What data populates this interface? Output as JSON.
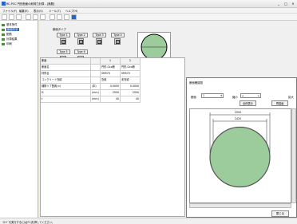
{
  "window": {
    "title": "RC-PCC 円形断面の耐荷力計算 - [無題]",
    "controls": [
      "_",
      "□",
      "×"
    ]
  },
  "menu": [
    "ファイル(F)",
    "編集(E)",
    "表示(V)",
    "ツール(T)",
    "ヘルプ(H)"
  ],
  "tree": [
    "基本条件",
    "断面形状",
    "配筋",
    "計算結果",
    "印刷"
  ],
  "section_group": {
    "title": "断面タイプ",
    "types": [
      "Type 1",
      "Type 2",
      "Type 3",
      "Type 4",
      "Type 5",
      "Type 6"
    ],
    "count_label": "断面数",
    "count_value": "1",
    "drawing_button": "断面図作図"
  },
  "grid": {
    "col_headers": [
      "断面",
      "",
      "1",
      "2"
    ],
    "rows": [
      [
        "断面名",
        "",
        "円形-Gco断",
        "円形-Gco断"
      ],
      [
        "材質名",
        "",
        "SM570",
        "SM570"
      ],
      [
        "コンクリート充填",
        "",
        "充填",
        "未充填"
      ],
      [
        "補剛リブ配置(×)",
        "(本)",
        "0.0000",
        "0.0000"
      ],
      [
        "D",
        "(mm)",
        "2500",
        "2500"
      ],
      [
        "t",
        "(mm)",
        "40",
        "40"
      ]
    ]
  },
  "drawing_window": {
    "title": "断面確認図",
    "section_label": "断面",
    "section_value": "1",
    "zoom_out_label": "縮小",
    "zoom_in_label": "拡大",
    "fit_button": "全体表示",
    "redraw_button": "再描画",
    "dim_outer": "2500",
    "dim_inner": "2420",
    "close_button": "閉じる"
  },
  "statusbar": {
    "message": "ｺﾏﾝﾄﾞを実行するには[F1]を押してください。"
  },
  "colors": {
    "circle_fill": "#9ccb9c",
    "icon_accent": "#2b64c8"
  }
}
